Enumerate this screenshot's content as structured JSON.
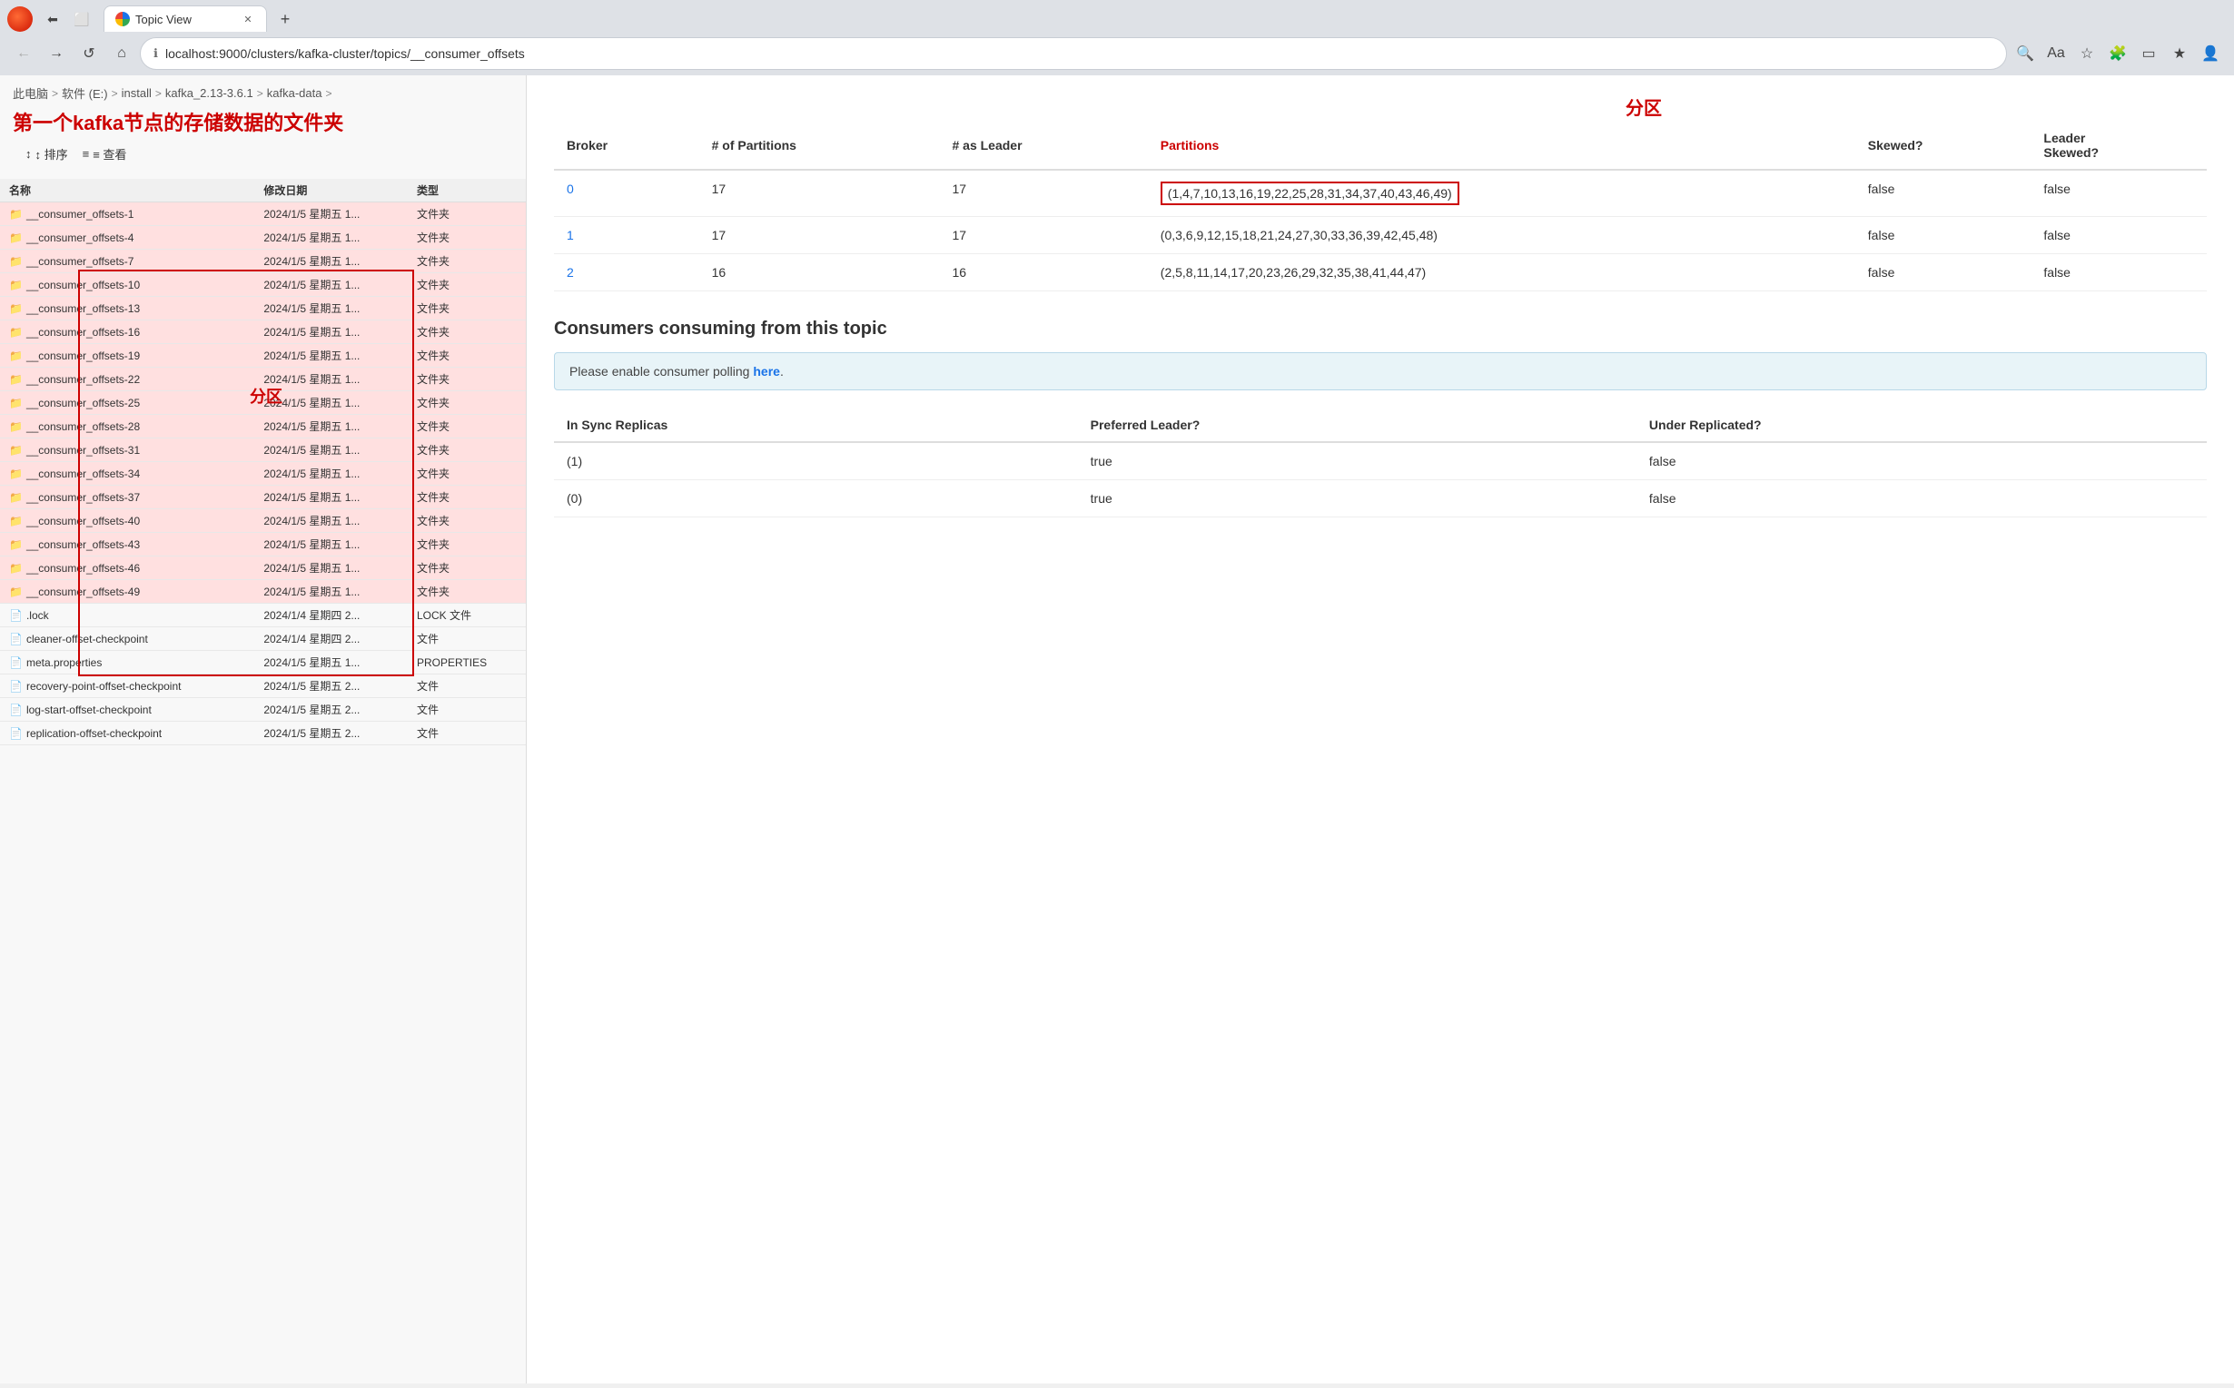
{
  "browser": {
    "tab_label": "Topic View",
    "address": "localhost:9000/clusters/kafka-cluster/topics/__consumer_offsets",
    "nav_back": "←",
    "nav_forward": "→",
    "nav_refresh": "↺",
    "nav_home": "⌂"
  },
  "file_explorer": {
    "breadcrumb": [
      "此电脑",
      "软件 (E:)",
      "install",
      "kafka_2.13-3.6.1",
      "kafka-data"
    ],
    "breadcrumb_seps": [
      ">",
      ">",
      ">",
      ">",
      ">"
    ],
    "annotation_title": "第一个kafka节点的存储数据的文件夹",
    "toolbar": {
      "sort_label": "↕ 排序",
      "view_label": "≡ 查看"
    },
    "columns": [
      "名称",
      "修改日期",
      "类型"
    ],
    "folders": [
      {
        "name": "__consumer_offsets-1",
        "date": "2024/1/5 星期五 1...",
        "type": "文件夹",
        "highlight": true
      },
      {
        "name": "__consumer_offsets-4",
        "date": "2024/1/5 星期五 1...",
        "type": "文件夹",
        "highlight": true
      },
      {
        "name": "__consumer_offsets-7",
        "date": "2024/1/5 星期五 1...",
        "type": "文件夹",
        "highlight": true
      },
      {
        "name": "__consumer_offsets-10",
        "date": "2024/1/5 星期五 1...",
        "type": "文件夹",
        "highlight": true
      },
      {
        "name": "__consumer_offsets-13",
        "date": "2024/1/5 星期五 1...",
        "type": "文件夹",
        "highlight": true
      },
      {
        "name": "__consumer_offsets-16",
        "date": "2024/1/5 星期五 1...",
        "type": "文件夹",
        "highlight": true
      },
      {
        "name": "__consumer_offsets-19",
        "date": "2024/1/5 星期五 1...",
        "type": "文件夹",
        "highlight": true
      },
      {
        "name": "__consumer_offsets-22",
        "date": "2024/1/5 星期五 1...",
        "type": "文件夹",
        "highlight": true
      },
      {
        "name": "__consumer_offsets-25",
        "date": "2024/1/5 星期五 1...",
        "type": "文件夹",
        "highlight": true
      },
      {
        "name": "__consumer_offsets-28",
        "date": "2024/1/5 星期五 1...",
        "type": "文件夹",
        "highlight": true
      },
      {
        "name": "__consumer_offsets-31",
        "date": "2024/1/5 星期五 1...",
        "type": "文件夹",
        "highlight": true
      },
      {
        "name": "__consumer_offsets-34",
        "date": "2024/1/5 星期五 1...",
        "type": "文件夹",
        "highlight": true
      },
      {
        "name": "__consumer_offsets-37",
        "date": "2024/1/5 星期五 1...",
        "type": "文件夹",
        "highlight": true
      },
      {
        "name": "__consumer_offsets-40",
        "date": "2024/1/5 星期五 1...",
        "type": "文件夹",
        "highlight": true
      },
      {
        "name": "__consumer_offsets-43",
        "date": "2024/1/5 星期五 1...",
        "type": "文件夹",
        "highlight": true
      },
      {
        "name": "__consumer_offsets-46",
        "date": "2024/1/5 星期五 1...",
        "type": "文件夹",
        "highlight": true
      },
      {
        "name": "__consumer_offsets-49",
        "date": "2024/1/5 星期五 1...",
        "type": "文件夹",
        "highlight": true
      }
    ],
    "files": [
      {
        "name": ".lock",
        "date": "2024/1/4 星期四 2...",
        "type": "LOCK 文件"
      },
      {
        "name": "cleaner-offset-checkpoint",
        "date": "2024/1/4 星期四 2...",
        "type": "文件"
      },
      {
        "name": "meta.properties",
        "date": "2024/1/5 星期五 1...",
        "type": "PROPERTIES"
      },
      {
        "name": "recovery-point-offset-checkpoint",
        "date": "2024/1/5 星期五 2...",
        "type": "文件"
      },
      {
        "name": "log-start-offset-checkpoint",
        "date": "2024/1/5 星期五 2...",
        "type": "文件"
      },
      {
        "name": "replication-offset-checkpoint",
        "date": "2024/1/5 星期五 2...",
        "type": "文件"
      }
    ],
    "partition_annotation": "分区"
  },
  "topic_panel": {
    "partition_annotation": "分区",
    "broker_table": {
      "columns": [
        "Broker",
        "# of Partitions",
        "# as Leader",
        "Partitions",
        "Skewed?",
        "Leader\nSkewed?"
      ],
      "rows": [
        {
          "broker": "0",
          "partitions_count": "17",
          "as_leader": "17",
          "partitions": "(1,4,7,10,13,16,19,22,25,28,31,34,37,40,43,46,49)",
          "skewed": "false",
          "leader_skewed": "false",
          "highlight_partition": true
        },
        {
          "broker": "1",
          "partitions_count": "17",
          "as_leader": "17",
          "partitions": "(0,3,6,9,12,15,18,21,24,27,30,33,36,39,42,45,48)",
          "skewed": "false",
          "leader_skewed": "false",
          "highlight_partition": false
        },
        {
          "broker": "2",
          "partitions_count": "16",
          "as_leader": "16",
          "partitions": "(2,5,8,11,14,17,20,23,26,29,32,35,38,41,44,47)",
          "skewed": "false",
          "leader_skewed": "false",
          "highlight_partition": false
        }
      ]
    },
    "consumers_section": {
      "title": "Consumers consuming from this topic",
      "notice_text": "Please enable consumer polling ",
      "notice_link": "here",
      "notice_end": "."
    },
    "replica_table": {
      "columns": [
        "In Sync Replicas",
        "Preferred Leader?",
        "Under Replicated?"
      ],
      "rows": [
        {
          "in_sync": "(1)",
          "preferred": "true",
          "under_replicated": "false"
        },
        {
          "in_sync": "(0)",
          "preferred": "true",
          "under_replicated": "false"
        }
      ]
    }
  }
}
